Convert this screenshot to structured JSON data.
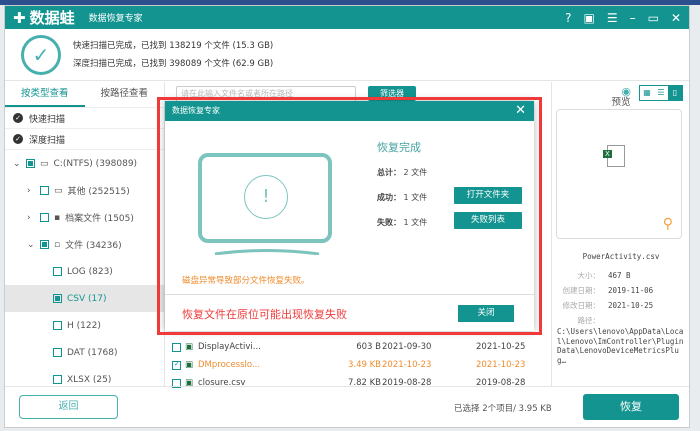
{
  "app": {
    "logo": "数据蛙",
    "subtitle": "数据恢复专家",
    "controls": [
      "help-icon",
      "save-icon",
      "menu-icon",
      "minimize-icon",
      "maximize-icon",
      "close-icon"
    ]
  },
  "header": {
    "quick": "快速扫描已完成，已找到 138219 个文件 (15.3 GB)",
    "deep": "深度扫描已完成，已找到 398089 个文件 (62.9 GB)"
  },
  "left": {
    "tabs": [
      "按类型查看",
      "按路径查看"
    ],
    "scans": [
      "快速扫描",
      "深度扫描"
    ],
    "tree": [
      {
        "label": "C:(NTFS) (398089)",
        "checked": "partial"
      },
      {
        "label": "其他 (252515)",
        "checked": false
      },
      {
        "label": "档案文件 (1505)",
        "checked": false
      },
      {
        "label": "文件 (34236)",
        "checked": "partial"
      },
      {
        "label": "LOG (823)",
        "checked": false
      },
      {
        "label": "CSV (17)",
        "checked": "partial",
        "selected": true
      },
      {
        "label": "H (122)",
        "checked": false
      },
      {
        "label": "DAT (1768)",
        "checked": false
      },
      {
        "label": "XLSX (25)",
        "checked": false
      }
    ]
  },
  "main": {
    "search_placeholder": "请在此输入文件名或者所在路径",
    "filter": "筛选器",
    "files": [
      {
        "name": "DisplayActivi...",
        "size": "603  B",
        "created": "2021-09-30",
        "modified": "2021-10-25",
        "checked": false
      },
      {
        "name": "DMprocesslo...",
        "size": "3.49 KB",
        "created": "2021-10-23",
        "modified": "2021-10-23",
        "checked": true
      },
      {
        "name": "closure.csv",
        "size": "7.82 KB",
        "created": "2019-08-28",
        "modified": "2019-08-28",
        "checked": false
      }
    ]
  },
  "preview": {
    "title": "预览",
    "filename": "PowerActivity.csv",
    "size_label": "大小：",
    "size": "467  B",
    "created_label": "创建日期：",
    "created": "2019-11-06",
    "modified_label": "修改日期：",
    "modified": "2021-10-25",
    "path_label": "路径：",
    "path": "C:\\Users\\lenovo\\AppData\\Local\\Lenovo\\ImController\\PluginData\\LenovoDeviceMetricsPlug…"
  },
  "footer": {
    "back": "返回",
    "selected": "已选择 2个项目/ 3.95 KB",
    "recover": "恢复"
  },
  "dialog": {
    "title": "数据恢复专家",
    "heading": "恢复完成",
    "total_label": "总计：",
    "total": "2 文件",
    "success_label": "成功：",
    "success": "1 文件",
    "fail_label": "失败：",
    "fail": "1 文件",
    "open_folder": "打开文件夹",
    "fail_list": "失败列表",
    "warning": "磁盘异常导致部分文件恢复失败。",
    "close": "关闭"
  },
  "annotation": "恢复文件在原位可能出现恢复失败",
  "colors": {
    "accent": "#139490",
    "warning": "#f08c2e",
    "annotation": "#f03a3a"
  }
}
